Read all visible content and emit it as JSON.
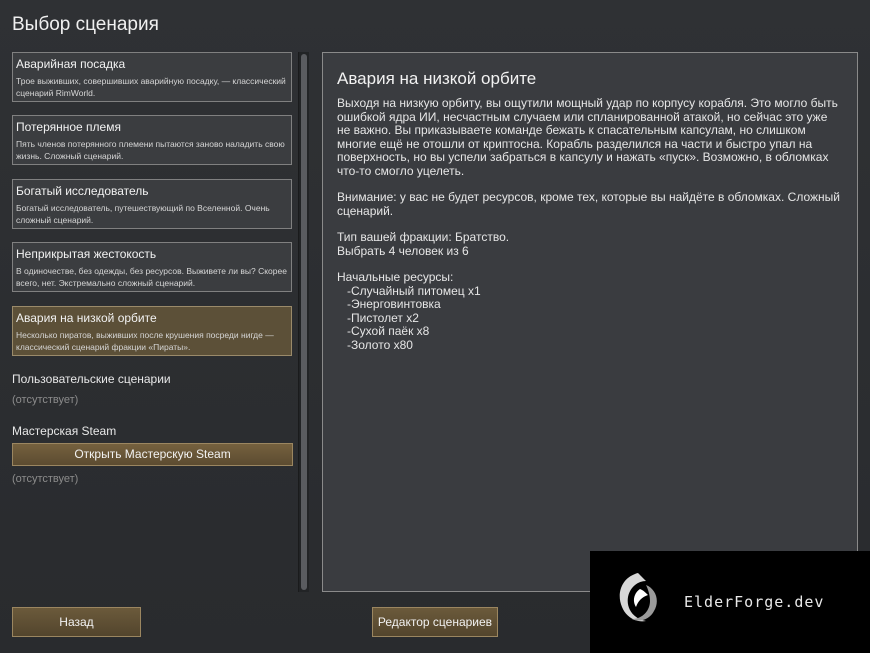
{
  "page": {
    "title": "Выбор сценария"
  },
  "scenarios": [
    {
      "title": "Аварийная посадка",
      "description": "Трое выживших, совершивших аварийную посадку, — классический сценарий RimWorld."
    },
    {
      "title": "Потерянное племя",
      "description": "Пять членов потерянного племени пытаются заново наладить свою жизнь. Сложный сценарий."
    },
    {
      "title": "Богатый исследователь",
      "description": "Богатый исследователь, путешествующий по Вселенной. Очень сложный сценарий."
    },
    {
      "title": "Неприкрытая жестокость",
      "description": "В одиночестве, без одежды, без ресурсов. Выживете ли вы? Скорее всего, нет. Экстремально сложный сценарий."
    },
    {
      "title": "Авария на низкой орбите",
      "description": "Несколько пиратов, выживших после крушения посреди нигде — классический сценарий фракции «Пираты»."
    }
  ],
  "custom_section": {
    "label": "Пользовательские сценарии",
    "absent": "(отсутствует)"
  },
  "workshop_section": {
    "label": "Мастерская Steam",
    "button_label": "Открыть Мастерскую Steam",
    "absent": "(отсутствует)"
  },
  "detail": {
    "title": "Авария на низкой орбите",
    "paragraph1": "Выходя на низкую орбиту, вы ощутили мощный удар по корпусу корабля. Это могло быть ошибкой ядра ИИ, несчастным случаем или спланированной атакой, но сейчас это уже не важно. Вы приказываете команде бежать к спасательным капсулам, но слишком многие ещё не отошли от криптосна. Корабль разделился на части и быстро упал на поверхность, но вы успели забраться в капсулу и нажать «пуск». Возможно, в обломках что-то смогло уцелеть.",
    "paragraph2": "Внимание: у вас не будет ресурсов, кроме тех, которые вы найдёте в обломках. Сложный сценарий.",
    "faction_line": "Тип вашей фракции: Братство.",
    "choose_line": "Выбрать 4  человек из 6",
    "resources_label": "Начальные ресурсы:",
    "resources": [
      "-Случайный питомец x1",
      "-Энерговинтовка",
      "-Пистолет x2",
      "-Сухой паёк x8",
      "-Золото x80"
    ]
  },
  "buttons": {
    "back": "Назад",
    "editor": "Редактор сценариев"
  },
  "watermark": {
    "text": "ElderForge.dev",
    "logo_icon": "dragon-logo"
  },
  "colors": {
    "selected_scenario": "#5c5038",
    "button_gold": "#6b5a3b",
    "background": "#2c2e31"
  }
}
